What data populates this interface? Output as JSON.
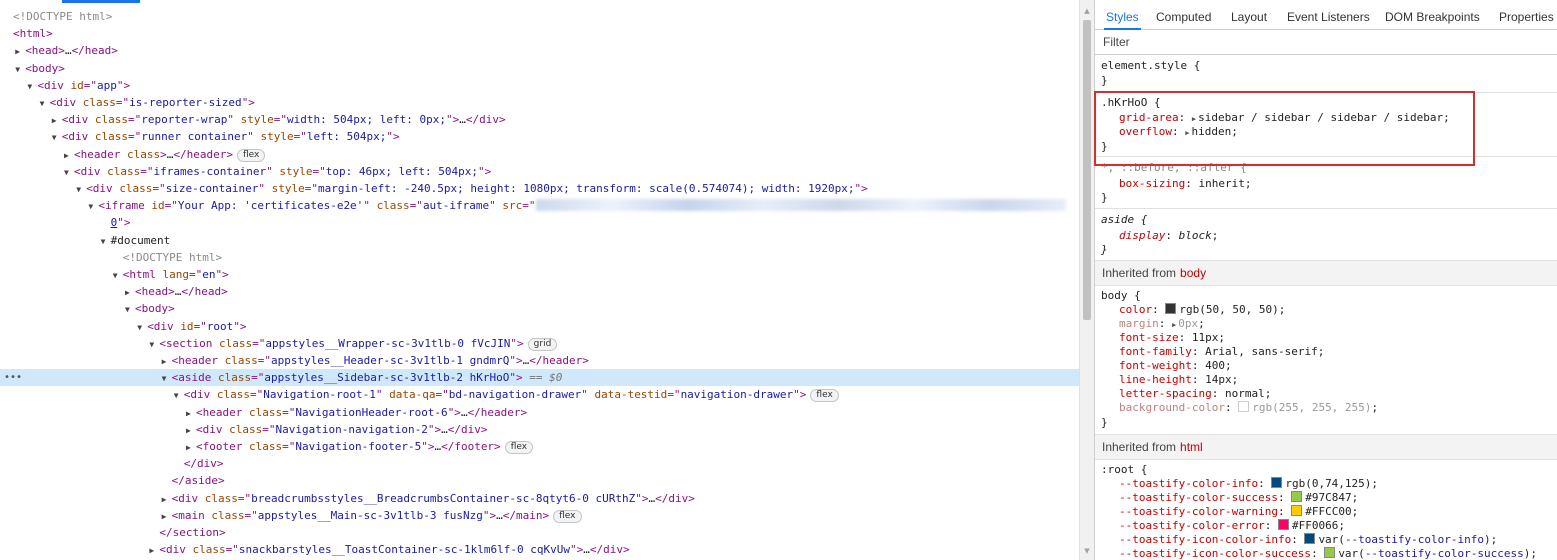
{
  "elements": {
    "lines": [
      {
        "depth": 0,
        "tri": "",
        "html": "<span class=\"comment\">&lt;!DOCTYPE html&gt;</span>"
      },
      {
        "depth": 0,
        "tri": "",
        "html": "<span class=\"tag\">&lt;html&gt;</span>"
      },
      {
        "depth": 1,
        "tri": "closed",
        "html": "<span class=\"tag\">&lt;head&gt;</span><span class=\"txt\">…</span><span class=\"tag\">&lt;/head&gt;</span>"
      },
      {
        "depth": 1,
        "tri": "open",
        "html": "<span class=\"tag\">&lt;body&gt;</span>"
      },
      {
        "depth": 2,
        "tri": "open",
        "html": "<span class=\"tag\">&lt;div </span><span class=\"an\">id</span><span class=\"tag\">=\"</span><span class=\"av\">app</span><span class=\"tag\">\"&gt;</span>"
      },
      {
        "depth": 3,
        "tri": "open",
        "html": "<span class=\"tag\">&lt;div </span><span class=\"an\">class</span><span class=\"tag\">=\"</span><span class=\"av\">is-reporter-sized</span><span class=\"tag\">\"&gt;</span>"
      },
      {
        "depth": 4,
        "tri": "closed",
        "html": "<span class=\"tag\">&lt;div </span><span class=\"an\">class</span><span class=\"tag\">=\"</span><span class=\"av\">reporter-wrap</span><span class=\"tag\">\" </span><span class=\"an\">style</span><span class=\"tag\">=\"</span><span class=\"av\">width: 504px; left: 0px;</span><span class=\"tag\">\"&gt;</span><span class=\"txt\">…</span><span class=\"tag\">&lt;/div&gt;</span>"
      },
      {
        "depth": 4,
        "tri": "open",
        "html": "<span class=\"tag\">&lt;div </span><span class=\"an\">class</span><span class=\"tag\">=\"</span><span class=\"av\">runner container</span><span class=\"tag\">\" </span><span class=\"an\">style</span><span class=\"tag\">=\"</span><span class=\"av\">left: 504px;</span><span class=\"tag\">\"&gt;</span>"
      },
      {
        "depth": 5,
        "tri": "closed",
        "html": "<span class=\"tag\">&lt;header </span><span class=\"an\">class</span><span class=\"tag\">&gt;</span><span class=\"txt\">…</span><span class=\"tag\">&lt;/header&gt;</span>",
        "badge": "flex"
      },
      {
        "depth": 5,
        "tri": "open",
        "html": "<span class=\"tag\">&lt;div </span><span class=\"an\">class</span><span class=\"tag\">=\"</span><span class=\"av\">iframes-container</span><span class=\"tag\">\" </span><span class=\"an\">style</span><span class=\"tag\">=\"</span><span class=\"av\">top: 46px; left: 504px;</span><span class=\"tag\">\"&gt;</span>"
      },
      {
        "depth": 6,
        "tri": "open",
        "html": "<span class=\"tag\">&lt;div </span><span class=\"an\">class</span><span class=\"tag\">=\"</span><span class=\"av\">size-container</span><span class=\"tag\">\" </span><span class=\"an\">style</span><span class=\"tag\">=\"</span><span class=\"av\">margin-left: -240.5px; height: 1080px; transform: scale(0.574074); width: 1920px;</span><span class=\"tag\">\"&gt;</span>"
      },
      {
        "depth": 7,
        "tri": "open",
        "html": "<span class=\"tag\">&lt;iframe </span><span class=\"an\">id</span><span class=\"tag\">=\"</span><span class=\"av\">Your App: 'certificates-e2e'</span><span class=\"tag\">\" </span><span class=\"an\">class</span><span class=\"tag\">=\"</span><span class=\"av\">aut-iframe</span><span class=\"tag\">\" </span><span class=\"an\">src</span><span class=\"tag\">=\"</span><span class=\"blur\"></span>"
      },
      {
        "depth": 8,
        "tri": "",
        "html": "<span class=\"av link\">0</span><span class=\"tag\">\"&gt;</span>"
      },
      {
        "depth": 8,
        "tri": "open",
        "html": "<span class=\"txt\">#document</span>"
      },
      {
        "depth": 9,
        "tri": "",
        "html": "<span class=\"comment\">&lt;!DOCTYPE html&gt;</span>"
      },
      {
        "depth": 9,
        "tri": "open",
        "html": "<span class=\"tag\">&lt;html </span><span class=\"an\">lang</span><span class=\"tag\">=\"</span><span class=\"av\">en</span><span class=\"tag\">\"&gt;</span>"
      },
      {
        "depth": 10,
        "tri": "closed",
        "html": "<span class=\"tag\">&lt;head&gt;</span><span class=\"txt\">…</span><span class=\"tag\">&lt;/head&gt;</span>"
      },
      {
        "depth": 10,
        "tri": "open",
        "html": "<span class=\"tag\">&lt;body&gt;</span>"
      },
      {
        "depth": 11,
        "tri": "open",
        "html": "<span class=\"tag\">&lt;div </span><span class=\"an\">id</span><span class=\"tag\">=\"</span><span class=\"av\">root</span><span class=\"tag\">\"&gt;</span>"
      },
      {
        "depth": 12,
        "tri": "open",
        "html": "<span class=\"tag\">&lt;section </span><span class=\"an\">class</span><span class=\"tag\">=\"</span><span class=\"av\">appstyles__Wrapper-sc-3v1tlb-0 fVcJIN</span><span class=\"tag\">\"&gt;</span>",
        "badge": "grid"
      },
      {
        "depth": 13,
        "tri": "closed",
        "html": "<span class=\"tag\">&lt;header </span><span class=\"an\">class</span><span class=\"tag\">=\"</span><span class=\"av\">appstyles__Header-sc-3v1tlb-1 gndmrQ</span><span class=\"tag\">\"&gt;</span><span class=\"txt\">…</span><span class=\"tag\">&lt;/header&gt;</span>"
      },
      {
        "depth": 13,
        "tri": "open",
        "selected": true,
        "html": "<span class=\"tag\">&lt;aside </span><span class=\"an\">class</span><span class=\"tag\">=\"</span><span class=\"av\">appstyles__Sidebar-sc-3v1tlb-2 hKrHoO</span><span class=\"tag\">\"&gt;</span> <span class=\"eq\">== $0</span>"
      },
      {
        "depth": 14,
        "tri": "open",
        "html": "<span class=\"tag\">&lt;div </span><span class=\"an\">class</span><span class=\"tag\">=\"</span><span class=\"av\">Navigation-root-1</span><span class=\"tag\">\" </span><span class=\"an\">data-qa</span><span class=\"tag\">=\"</span><span class=\"av\">bd-navigation-drawer</span><span class=\"tag\">\" </span><span class=\"an\">data-testid</span><span class=\"tag\">=\"</span><span class=\"av\">navigation-drawer</span><span class=\"tag\">\"&gt;</span>",
        "badge": "flex"
      },
      {
        "depth": 15,
        "tri": "closed",
        "html": "<span class=\"tag\">&lt;header </span><span class=\"an\">class</span><span class=\"tag\">=\"</span><span class=\"av\">NavigationHeader-root-6</span><span class=\"tag\">\"&gt;</span><span class=\"txt\">…</span><span class=\"tag\">&lt;/header&gt;</span>"
      },
      {
        "depth": 15,
        "tri": "closed",
        "html": "<span class=\"tag\">&lt;div </span><span class=\"an\">class</span><span class=\"tag\">=\"</span><span class=\"av\">Navigation-navigation-2</span><span class=\"tag\">\"&gt;</span><span class=\"txt\">…</span><span class=\"tag\">&lt;/div&gt;</span>"
      },
      {
        "depth": 15,
        "tri": "closed",
        "html": "<span class=\"tag\">&lt;footer </span><span class=\"an\">class</span><span class=\"tag\">=\"</span><span class=\"av\">Navigation-footer-5</span><span class=\"tag\">\"&gt;</span><span class=\"txt\">…</span><span class=\"tag\">&lt;/footer&gt;</span>",
        "badge": "flex"
      },
      {
        "depth": 14,
        "tri": "",
        "html": "<span class=\"tag\">&lt;/div&gt;</span>"
      },
      {
        "depth": 13,
        "tri": "",
        "html": "<span class=\"tag\">&lt;/aside&gt;</span>"
      },
      {
        "depth": 13,
        "tri": "closed",
        "html": "<span class=\"tag\">&lt;div </span><span class=\"an\">class</span><span class=\"tag\">=\"</span><span class=\"av\">breadcrumbsstyles__BreadcrumbsContainer-sc-8qtyt6-0 cURthZ</span><span class=\"tag\">\"&gt;</span><span class=\"txt\">…</span><span class=\"tag\">&lt;/div&gt;</span>"
      },
      {
        "depth": 13,
        "tri": "closed",
        "html": "<span class=\"tag\">&lt;main </span><span class=\"an\">class</span><span class=\"tag\">=\"</span><span class=\"av\">appstyles__Main-sc-3v1tlb-3 fusNzg</span><span class=\"tag\">\"&gt;</span><span class=\"txt\">…</span><span class=\"tag\">&lt;/main&gt;</span>",
        "badge": "flex"
      },
      {
        "depth": 12,
        "tri": "",
        "html": "<span class=\"tag\">&lt;/section&gt;</span>"
      },
      {
        "depth": 12,
        "tri": "closed",
        "html": "<span class=\"tag\">&lt;div </span><span class=\"an\">class</span><span class=\"tag\">=\"</span><span class=\"av\">snackbarstyles__ToastContainer-sc-1klm6lf-0 cqKvUw</span><span class=\"tag\">\"&gt;</span><span class=\"txt\">…</span><span class=\"tag\">&lt;/div&gt;</span>"
      }
    ],
    "selected_dots": "•••"
  },
  "sidebar": {
    "tabs": [
      "Styles",
      "Computed",
      "Layout",
      "Event Listeners",
      "DOM Breakpoints",
      "Properties"
    ],
    "active_tab": "Styles",
    "filter_placeholder": "Filter",
    "element_style": {
      "selector": "element.style {",
      "close": "}"
    },
    "hkrhoo": {
      "selector": ".hKrHoO {",
      "props": [
        {
          "name": "grid-area",
          "value": "sidebar / sidebar / sidebar / sidebar"
        },
        {
          "name": "overflow",
          "value": "hidden"
        }
      ],
      "close": "}"
    },
    "universal": {
      "selector": "*, ::before, ::after {",
      "prop": "box-sizing",
      "value": "inherit",
      "close": "}"
    },
    "aside": {
      "selector": "aside {",
      "prop": "display",
      "value": "block",
      "close": "}"
    },
    "inherited_body": {
      "label": "Inherited from",
      "source": "body"
    },
    "body_rule": {
      "selector": "body {",
      "props": [
        {
          "name": "color",
          "value": "rgb(50, 50, 50)",
          "swatch": "#323232"
        },
        {
          "name": "margin",
          "value": "0px",
          "dim": true,
          "tri": true
        },
        {
          "name": "font-size",
          "value": "11px"
        },
        {
          "name": "font-family",
          "value": "Arial, sans-serif"
        },
        {
          "name": "font-weight",
          "value": "400"
        },
        {
          "name": "line-height",
          "value": "14px"
        },
        {
          "name": "letter-spacing",
          "value": "normal"
        },
        {
          "name": "background-color",
          "value": "rgb(255, 255, 255)",
          "dim": true,
          "swatch": "#ffffff"
        }
      ],
      "close": "}"
    },
    "inherited_html": {
      "label": "Inherited from",
      "source": "html"
    },
    "root_rule": {
      "selector": ":root {",
      "props": [
        {
          "name": "--toastify-color-info",
          "value": "rgb(0,74,125)",
          "swatch": "#004a7d"
        },
        {
          "name": "--toastify-color-success",
          "value": "#97C847",
          "swatch": "#97c847"
        },
        {
          "name": "--toastify-color-warning",
          "value": "#FFCC00",
          "swatch": "#ffcc00"
        },
        {
          "name": "--toastify-color-error",
          "value": "#FF0066",
          "swatch": "#ff0066"
        },
        {
          "name": "--toastify-icon-color-info",
          "value": "var(--toastify-color-info)",
          "swatch": "#004a7d",
          "var": "--toastify-color-info"
        },
        {
          "name": "--toastify-icon-color-success",
          "value": "var(--toastify-color-success)",
          "swatch": "#97c847",
          "var": "--toastify-color-success"
        }
      ]
    }
  },
  "colors": {
    "accent": "#1a73e8",
    "highlight_border": "#d32f2f",
    "selected_row": "#cfe8fc"
  }
}
